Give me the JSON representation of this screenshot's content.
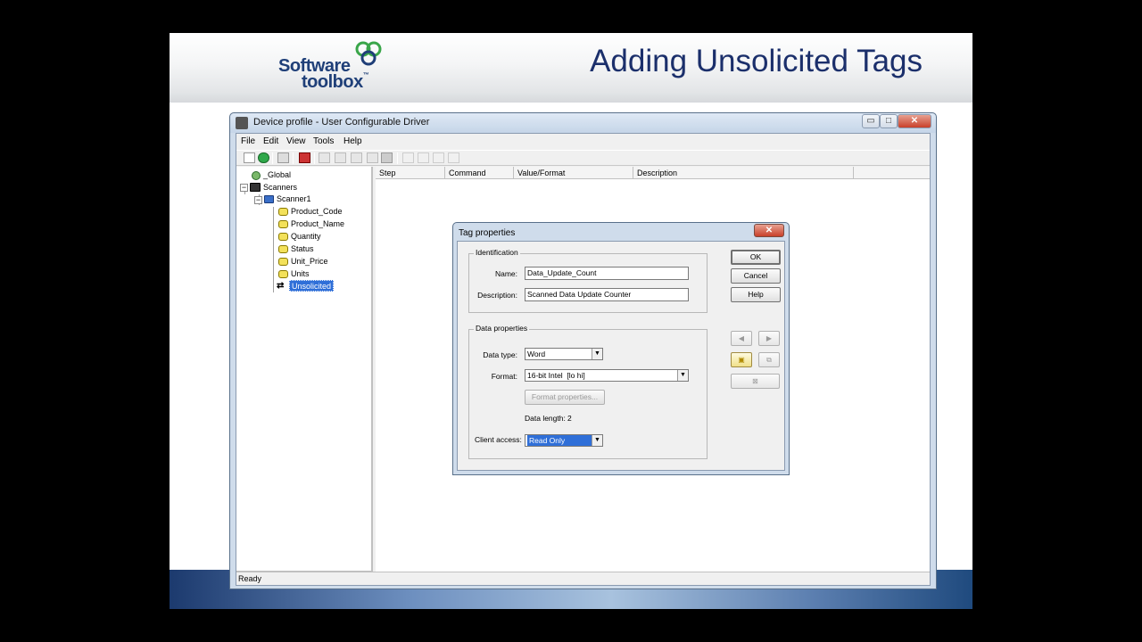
{
  "slide": {
    "title": "Adding Unsolicited Tags",
    "logo": {
      "line1": "Software",
      "line2": "toolbox",
      "tm": "™"
    }
  },
  "app": {
    "title": "Device profile - User Configurable Driver",
    "window_buttons": {
      "minimize": "▭",
      "maximize": "□",
      "close": "✕"
    },
    "menu": [
      "File",
      "Edit",
      "View",
      "Tools",
      "Help"
    ],
    "tree": {
      "global": "_Global",
      "scanners": "Scanners",
      "scanner1": "Scanner1",
      "tags": [
        "Product_Code",
        "Product_Name",
        "Quantity",
        "Status",
        "Unit_Price",
        "Units"
      ],
      "selected": "Unsolicited"
    },
    "columns": [
      "Step",
      "Command",
      "Value/Format",
      "Description"
    ],
    "status": "Ready"
  },
  "dialog": {
    "title": "Tag properties",
    "close": "✕",
    "identification": {
      "label": "Identification",
      "name_label": "Name:",
      "name_value": "Data_Update_Count",
      "description_label": "Description:",
      "description_value": "Scanned Data Update Counter"
    },
    "data_properties": {
      "label": "Data properties",
      "data_type_label": "Data type:",
      "data_type_value": "Word",
      "format_label": "Format:",
      "format_value": "16-bit Intel  [lo hi]",
      "format_properties_button": "Format properties...",
      "data_length_label": "Data length:",
      "data_length_value": "2",
      "client_access_label": "Client access:",
      "client_access_value": "Read Only"
    },
    "buttons": {
      "ok": "OK",
      "cancel": "Cancel",
      "help": "Help"
    },
    "nav": {
      "prev": "◀",
      "next": "▶",
      "new": "▣",
      "copy": "⧉",
      "delete": "⊠"
    }
  }
}
